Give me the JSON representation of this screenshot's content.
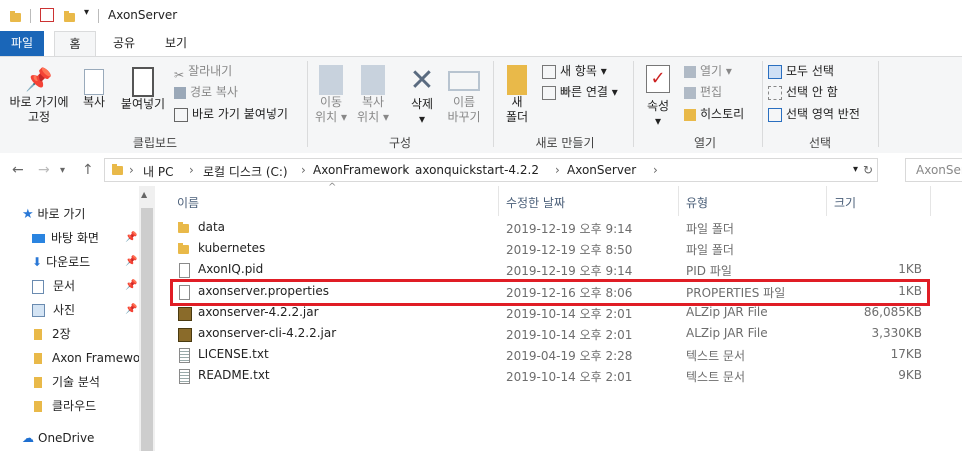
{
  "window": {
    "title": "AxonServer"
  },
  "tabs": [
    "파일",
    "홈",
    "공유",
    "보기"
  ],
  "ribbon": {
    "clipboard": {
      "pin_label_1": "바로 가기에",
      "pin_label_2": "고정",
      "copy": "복사",
      "paste": "붙여넣기",
      "cut": "잘라내기",
      "copy_path": "경로 복사",
      "paste_shortcut": "바로 가기 붙여넣기",
      "group": "클립보드"
    },
    "organize": {
      "move_1": "이동",
      "move_2": "위치",
      "copy_1": "복사",
      "copy_2": "위치",
      "delete": "삭제",
      "rename_1": "이름",
      "rename_2": "바꾸기",
      "group": "구성"
    },
    "new": {
      "folder_1": "새",
      "folder_2": "폴더",
      "new_item": "새 항목",
      "easy_access": "빠른 연결",
      "group": "새로 만들기"
    },
    "open": {
      "properties": "속성",
      "open": "열기",
      "edit": "편집",
      "history": "히스토리",
      "group": "열기"
    },
    "select": {
      "select_all": "모두 선택",
      "select_none": "선택 안 함",
      "invert": "선택 영역 반전",
      "group": "선택"
    }
  },
  "address": {
    "crumbs": [
      "내 PC",
      "로컬 디스크 (C:)",
      "AxonFramework",
      "axonquickstart-4.2.2",
      "AxonServer"
    ],
    "search_placeholder": "AxonServ"
  },
  "nav_pane": {
    "quick_access": "바로 가기",
    "items": [
      "바탕 화면",
      "다운로드",
      "문서",
      "사진",
      "2장",
      "Axon Framewor",
      "기술 분석",
      "클라우드"
    ],
    "onedrive": "OneDrive"
  },
  "columns": {
    "name": "이름",
    "date": "수정한 날짜",
    "type": "유형",
    "size": "크기"
  },
  "files": [
    {
      "name": "data",
      "date": "2019-12-19 오후 9:14",
      "type": "파일 폴더",
      "size": "",
      "icon": "folder-icon"
    },
    {
      "name": "kubernetes",
      "date": "2019-12-19 오후 8:50",
      "type": "파일 폴더",
      "size": "",
      "icon": "folder-icon"
    },
    {
      "name": "AxonIQ.pid",
      "date": "2019-12-19 오후 9:14",
      "type": "PID 파일",
      "size": "1KB",
      "icon": "file-icon"
    },
    {
      "name": "axonserver.properties",
      "date": "2019-12-16 오후 8:06",
      "type": "PROPERTIES 파일",
      "size": "1KB",
      "icon": "file-icon"
    },
    {
      "name": "axonserver-4.2.2.jar",
      "date": "2019-10-14 오후 2:01",
      "type": "ALZip JAR File",
      "size": "86,085KB",
      "icon": "jar-icon"
    },
    {
      "name": "axonserver-cli-4.2.2.jar",
      "date": "2019-10-14 오후 2:01",
      "type": "ALZip JAR File",
      "size": "3,330KB",
      "icon": "jar-icon"
    },
    {
      "name": "LICENSE.txt",
      "date": "2019-04-19 오후 2:28",
      "type": "텍스트 문서",
      "size": "17KB",
      "icon": "text-file-icon"
    },
    {
      "name": "README.txt",
      "date": "2019-10-14 오후 2:01",
      "type": "텍스트 문서",
      "size": "9KB",
      "icon": "text-file-icon"
    }
  ],
  "highlight_color": "#e01d25"
}
